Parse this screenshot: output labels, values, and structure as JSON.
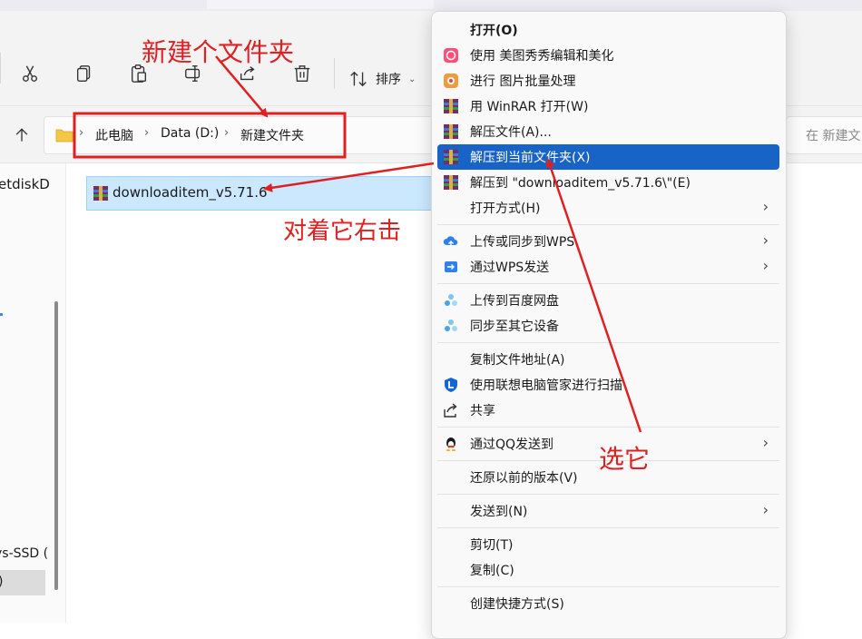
{
  "toolbar": {
    "sort_label": "排序"
  },
  "address": {
    "crumbs": [
      "此电脑",
      "Data (D:)",
      "新建文件夹"
    ],
    "search_placeholder": "在 新建文"
  },
  "nav": {
    "netdisk_label": "etdiskD",
    "ssd_label": "ys-SSD (",
    "selected_label": ")"
  },
  "file": {
    "name": "downloaditem_v5.71.6"
  },
  "menu": {
    "items": [
      {
        "label": "打开(O)"
      },
      {
        "label": "使用 美图秀秀编辑和美化"
      },
      {
        "label": "进行 图片批量处理"
      },
      {
        "label": "用 WinRAR 打开(W)"
      },
      {
        "label": "解压文件(A)..."
      },
      {
        "label": "解压到当前文件夹(X)"
      },
      {
        "label": "解压到 \"downloaditem_v5.71.6\\\"(E)"
      },
      {
        "label": "打开方式(H)"
      },
      {
        "label": "上传或同步到WPS"
      },
      {
        "label": "通过WPS发送"
      },
      {
        "label": "上传到百度网盘"
      },
      {
        "label": "同步至其它设备"
      },
      {
        "label": "复制文件地址(A)"
      },
      {
        "label": "使用联想电脑管家进行扫描"
      },
      {
        "label": "共享"
      },
      {
        "label": "通过QQ发送到"
      },
      {
        "label": "还原以前的版本(V)"
      },
      {
        "label": "发送到(N)"
      },
      {
        "label": "剪切(T)"
      },
      {
        "label": "复制(C)"
      },
      {
        "label": "创建快捷方式(S)"
      }
    ]
  },
  "annotations": {
    "new_folder": "新建个文件夹",
    "right_click": "对着它右击",
    "select_it": "选它",
    "color": "#e02020"
  },
  "colors": {
    "highlight": "#1863c6",
    "file_selection": "#cce8ff",
    "winrar": "#7a2a6a"
  }
}
